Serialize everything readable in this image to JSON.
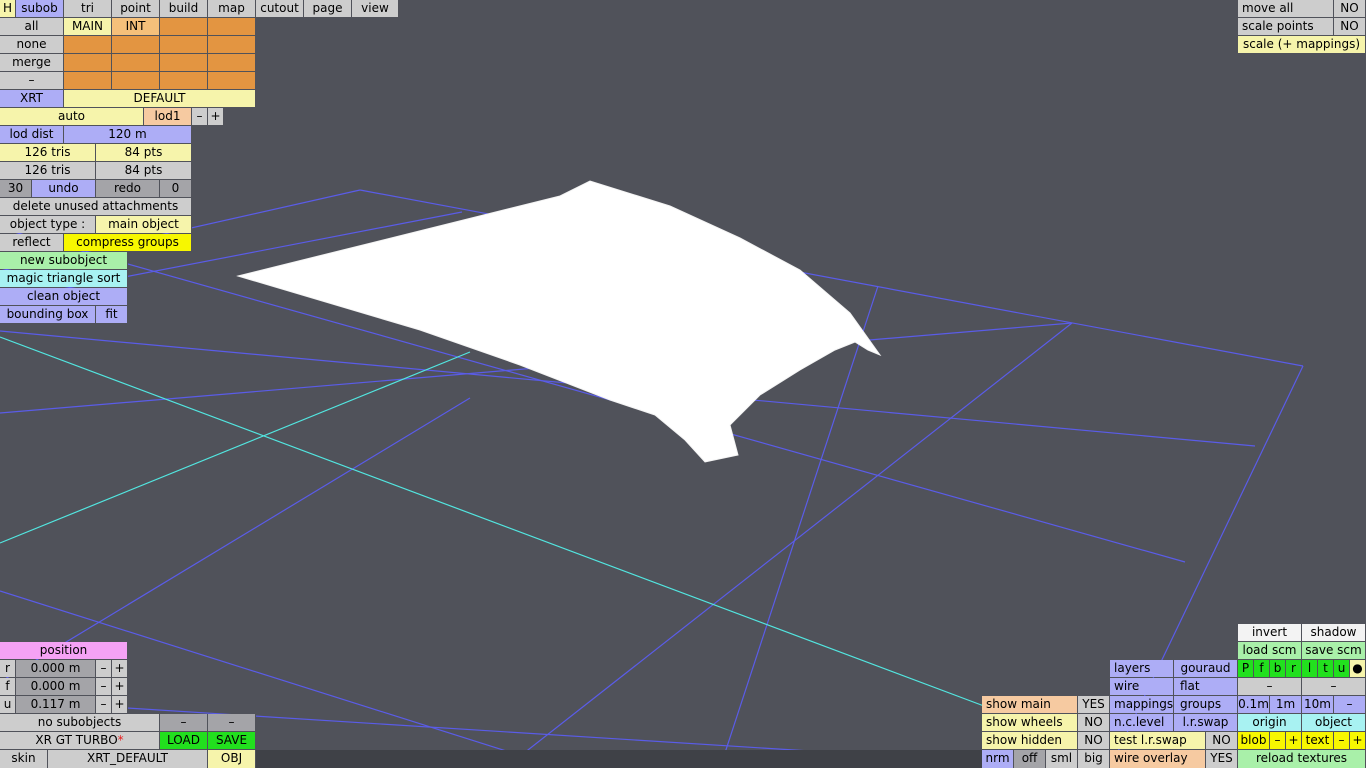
{
  "top_menu": {
    "h": "H",
    "subob": "subob",
    "tri": "tri",
    "point": "point",
    "build": "build",
    "map": "map",
    "cutout": "cutout",
    "page": "page",
    "view": "view"
  },
  "subobject_panel": {
    "all": "all",
    "none": "none",
    "merge": "merge",
    "dash": "–",
    "main": "MAIN",
    "int": "INT",
    "xrt": "XRT",
    "default": "DEFAULT",
    "auto": "auto",
    "lod": "lod1",
    "lod_minus": "–",
    "lod_plus": "+",
    "lod_dist_label": "lod dist",
    "lod_dist_value": "120 m",
    "tris_1": "126 tris",
    "pts_1": "84 pts",
    "tris_2": "126 tris",
    "pts_2": "84 pts",
    "undo_count": "30",
    "undo": "undo",
    "redo": "redo",
    "redo_count": "0",
    "delete_unused": "delete unused attachments",
    "object_type_label": "object type :",
    "object_type_value": "main object",
    "reflect": "reflect",
    "compress_groups": "compress groups",
    "new_subobject": "new subobject",
    "magic_sort": "magic triangle sort",
    "clean_object": "clean object",
    "bounding_box": "bounding box",
    "fit": "fit"
  },
  "top_right": {
    "move_all": "move all",
    "move_all_value": "NO",
    "scale_points": "scale points",
    "scale_points_value": "NO",
    "scale_mappings": "scale (+ mappings)"
  },
  "position_panel": {
    "title": "position",
    "r_label": "r",
    "r_value": "0.000 m",
    "f_label": "f",
    "f_value": "0.000 m",
    "u_label": "u",
    "u_value": "0.117 m",
    "minus": "–",
    "plus": "+"
  },
  "bottom_left": {
    "no_subobjects": "no subobjects",
    "dash1": "–",
    "dash2": "–",
    "car_name": "XR GT TURBO",
    "modified_marker": "*",
    "load": "LOAD",
    "save": "SAVE",
    "skin": "skin",
    "skin_value": "XRT_DEFAULT",
    "obj": "OBJ"
  },
  "view_options": {
    "show_main": "show main",
    "show_main_value": "YES",
    "show_wheels": "show wheels",
    "show_wheels_value": "NO",
    "show_hidden": "show hidden",
    "show_hidden_value": "NO",
    "nrm": "nrm",
    "off": "off",
    "sml": "sml",
    "big": "big",
    "layers": "layers",
    "gouraud": "gouraud",
    "wire": "wire",
    "flat": "flat",
    "mappings": "mappings",
    "groups": "groups",
    "nc_level": "n.c.level",
    "lr_swap": "l.r.swap",
    "test_lr_swap": "test l.r.swap",
    "test_lr_swap_value": "NO",
    "wire_overlay": "wire overlay",
    "wire_overlay_value": "YES"
  },
  "bottom_right": {
    "invert": "invert",
    "shadow": "shadow",
    "load_scm": "load scm",
    "save_scm": "save scm",
    "letters": [
      "P",
      "f",
      "b",
      "r",
      "l",
      "t",
      "u",
      "●"
    ],
    "dash_a": "–",
    "dash_b": "–",
    "step_01": "0.1m",
    "step_1": "1m",
    "step_10": "10m",
    "step_minus": "–",
    "origin": "origin",
    "object": "object",
    "blob": "blob",
    "blob_minus": "–",
    "blob_plus": "+",
    "text": "text",
    "text_minus": "–",
    "text_plus": "+",
    "reload_textures": "reload textures"
  },
  "colors": {
    "background": "#50525a",
    "grid_lines": "#5a5ce8",
    "axis_line": "#52e6e0",
    "mesh": "#ffffff"
  }
}
